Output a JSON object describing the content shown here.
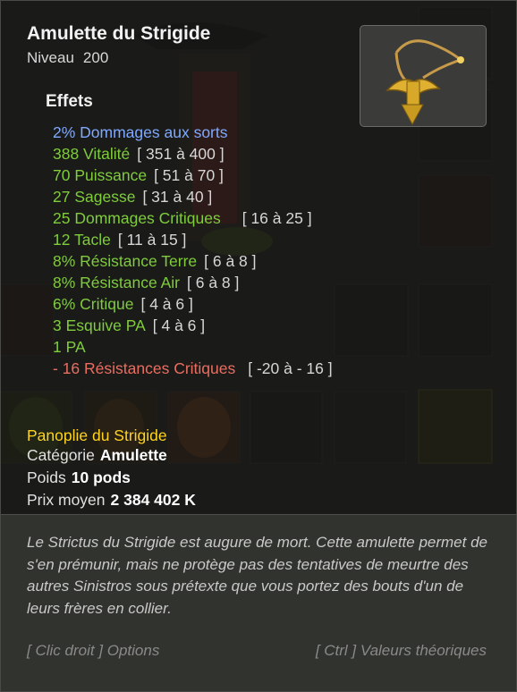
{
  "item": {
    "name": "Amulette du Strigide",
    "level_label": "Niveau",
    "level_value": "200",
    "icon": "golden-amulet-icon"
  },
  "effects": {
    "title": "Effets",
    "lines": [
      {
        "text": "2% Dommages aux sorts",
        "range": "",
        "color": "blue"
      },
      {
        "text": "388 Vitalité",
        "range": "[ 351 à 400 ]",
        "color": "green"
      },
      {
        "text": "70 Puissance",
        "range": "[ 51 à 70 ]",
        "color": "green"
      },
      {
        "text": "27 Sagesse",
        "range": "[ 31 à 40 ]",
        "color": "green"
      },
      {
        "text": "25 Dommages Critiques",
        "range": "[ 16 à 25 ]",
        "color": "green"
      },
      {
        "text": "12 Tacle",
        "range": "[ 11 à 15 ]",
        "color": "green"
      },
      {
        "text": "8% Résistance Terre",
        "range": "[ 6 à 8 ]",
        "color": "green"
      },
      {
        "text": "8% Résistance Air",
        "range": "[ 6 à 8 ]",
        "color": "green"
      },
      {
        "text": "6% Critique",
        "range": "[ 4 à 6 ]",
        "color": "green"
      },
      {
        "text": "3 Esquive PA",
        "range": "[ 4 à 6 ]",
        "color": "green"
      },
      {
        "text": "1 PA",
        "range": "",
        "color": "green"
      },
      {
        "text": "- 16 Résistances Critiques",
        "range": "[ -20 à - 16 ]",
        "color": "red"
      }
    ]
  },
  "set": "Panoplie du Strigide",
  "info": {
    "category_label": "Catégorie",
    "category_value": "Amulette",
    "weight_label": "Poids",
    "weight_value": "10 pods",
    "price_label": "Prix moyen",
    "price_value": "2 384 402 K"
  },
  "description": "Le Strictus du Strigide est augure de mort. Cette amulette permet de s'en prémunir, mais ne protège pas des tentatives de meurtre des autres Sinistros sous prétexte que vous portez des bouts d'un de leurs frères en collier.",
  "hints": {
    "options": "[ Clic droit ] Options",
    "theoretical": "[ Ctrl ] Valeurs théoriques"
  },
  "colors": {
    "bonus_blue": "#7fa8ff",
    "bonus_green": "#7fcc3c",
    "malus_red": "#e86e62",
    "set_yellow": "#ffd21e"
  }
}
